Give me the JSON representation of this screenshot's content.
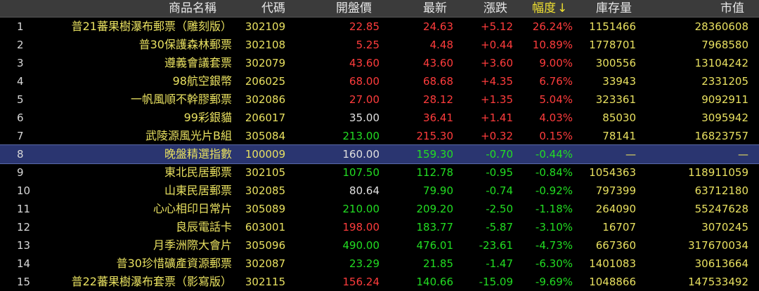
{
  "header": {
    "name": "商品名稱",
    "code": "代碼",
    "open": "開盤價",
    "last": "最新",
    "change": "漲跌",
    "pct": "幅度",
    "sort_arrow": "↓",
    "stock": "庫存量",
    "mcap": "市值"
  },
  "colors": {
    "up": "#ff3c3c",
    "down": "#22dd22",
    "flat": "#e0e0e0",
    "highlight_row": "#2a3570",
    "header_bg": "#3b3b3b",
    "text_yellow": "#e8e060"
  },
  "selected_row": 8,
  "rows": [
    {
      "idx": "1",
      "name": "普21蕃果樹瀑布郵票（雕刻版）",
      "code": "302109",
      "open": "22.85",
      "open_dir": "up",
      "last": "24.63",
      "last_dir": "up",
      "change": "+5.12",
      "pct": "26.24%",
      "dir": "up",
      "stock": "1151466",
      "mcap": "28360608"
    },
    {
      "idx": "2",
      "name": "普30保護森林郵票",
      "code": "302108",
      "open": "5.25",
      "open_dir": "up",
      "last": "4.48",
      "last_dir": "up",
      "change": "+0.44",
      "pct": "10.89%",
      "dir": "up",
      "stock": "1778701",
      "mcap": "7968580"
    },
    {
      "idx": "3",
      "name": "遵義會議套票",
      "code": "302079",
      "open": "43.60",
      "open_dir": "up",
      "last": "43.60",
      "last_dir": "up",
      "change": "+3.60",
      "pct": "9.00%",
      "dir": "up",
      "stock": "300556",
      "mcap": "13104242"
    },
    {
      "idx": "4",
      "name": "98航空銀幣",
      "code": "206025",
      "open": "68.00",
      "open_dir": "up",
      "last": "68.68",
      "last_dir": "up",
      "change": "+4.35",
      "pct": "6.76%",
      "dir": "up",
      "stock": "33943",
      "mcap": "2331205"
    },
    {
      "idx": "5",
      "name": "一帆風順不幹膠郵票",
      "code": "302086",
      "open": "27.00",
      "open_dir": "up",
      "last": "28.12",
      "last_dir": "up",
      "change": "+1.35",
      "pct": "5.04%",
      "dir": "up",
      "stock": "323361",
      "mcap": "9092911"
    },
    {
      "idx": "6",
      "name": "99彩銀貓",
      "code": "206017",
      "open": "35.00",
      "open_dir": "flat",
      "last": "36.41",
      "last_dir": "up",
      "change": "+1.41",
      "pct": "4.03%",
      "dir": "up",
      "stock": "85030",
      "mcap": "3095942"
    },
    {
      "idx": "7",
      "name": "武陵源風光片B組",
      "code": "305084",
      "open": "213.00",
      "open_dir": "down",
      "last": "215.30",
      "last_dir": "up",
      "change": "+0.32",
      "pct": "0.15%",
      "dir": "up",
      "stock": "78141",
      "mcap": "16823757"
    },
    {
      "idx": "8",
      "name": "晚盤精選指數",
      "code": "100009",
      "open": "160.00",
      "open_dir": "flat",
      "last": "159.30",
      "last_dir": "down",
      "change": "-0.70",
      "pct": "-0.44%",
      "dir": "down",
      "stock": "—",
      "mcap": "—"
    },
    {
      "idx": "9",
      "name": "東北民居郵票",
      "code": "302105",
      "open": "107.50",
      "open_dir": "down",
      "last": "112.78",
      "last_dir": "down",
      "change": "-0.95",
      "pct": "-0.84%",
      "dir": "down",
      "stock": "1054363",
      "mcap": "118911059"
    },
    {
      "idx": "10",
      "name": "山東民居郵票",
      "code": "302085",
      "open": "80.64",
      "open_dir": "flat",
      "last": "79.90",
      "last_dir": "down",
      "change": "-0.74",
      "pct": "-0.92%",
      "dir": "down",
      "stock": "797399",
      "mcap": "63712180"
    },
    {
      "idx": "11",
      "name": "心心相印日常片",
      "code": "305089",
      "open": "210.00",
      "open_dir": "down",
      "last": "209.20",
      "last_dir": "down",
      "change": "-2.50",
      "pct": "-1.18%",
      "dir": "down",
      "stock": "264090",
      "mcap": "55247628"
    },
    {
      "idx": "12",
      "name": "良辰電話卡",
      "code": "603001",
      "open": "198.00",
      "open_dir": "up",
      "last": "183.77",
      "last_dir": "down",
      "change": "-5.87",
      "pct": "-3.10%",
      "dir": "down",
      "stock": "16707",
      "mcap": "3070245"
    },
    {
      "idx": "13",
      "name": "月季洲際大會片",
      "code": "305096",
      "open": "490.00",
      "open_dir": "down",
      "last": "476.01",
      "last_dir": "down",
      "change": "-23.61",
      "pct": "-4.73%",
      "dir": "down",
      "stock": "667360",
      "mcap": "317670034"
    },
    {
      "idx": "14",
      "name": "普30珍惜礦產資源郵票",
      "code": "302087",
      "open": "23.29",
      "open_dir": "down",
      "last": "21.85",
      "last_dir": "down",
      "change": "-1.47",
      "pct": "-6.30%",
      "dir": "down",
      "stock": "1401083",
      "mcap": "30613664"
    },
    {
      "idx": "15",
      "name": "普22蕃果樹瀑布套票（影寫版）",
      "code": "302115",
      "open": "156.24",
      "open_dir": "up",
      "last": "140.66",
      "last_dir": "down",
      "change": "-15.09",
      "pct": "-9.69%",
      "dir": "down",
      "stock": "1048866",
      "mcap": "147533492"
    }
  ]
}
